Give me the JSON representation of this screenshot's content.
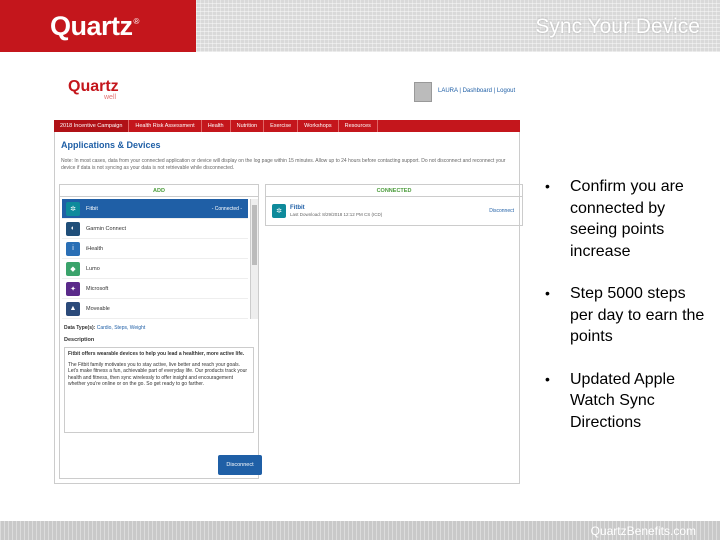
{
  "slide": {
    "brand": "Quartz",
    "brand_tm": "®",
    "title": "Sync Your Device",
    "footer": "QuartzBenefits.com",
    "bullets": [
      "Confirm you are connected by seeing points increase",
      "Step 5000 steps per day to earn the points",
      "Updated Apple Watch Sync Directions"
    ]
  },
  "screenshot": {
    "logo": "Quartz",
    "logo_sub": "well",
    "user_links": "LAURA | Dashboard | Logout",
    "nav": [
      "2018 Incentive Campaign",
      "Health Risk Assessment",
      "Health",
      "Nutrition",
      "Exercise",
      "Workshops",
      "Resources"
    ],
    "page_title": "Applications & Devices",
    "note": "Note: In most cases, data from your connected application or device will display on the log page within 15 minutes. Allow up to 24 hours before contacting support. Do not disconnect and reconnect your device if data is not syncing as your data is not retrievable while disconnected.",
    "add_header": "ADD",
    "connected_header": "CONNECTED",
    "apps": [
      {
        "name": "Fitbit",
        "state": "- Connected -",
        "icon": "fitbit-icon",
        "color": "#0e8a9b"
      },
      {
        "name": "Garmin Connect",
        "state": "",
        "icon": "garmin-icon",
        "color": "#1f4e79"
      },
      {
        "name": "iHealth",
        "state": "",
        "icon": "ihealth-icon",
        "color": "#2a6fb5"
      },
      {
        "name": "Lumo",
        "state": "",
        "icon": "lumo-icon",
        "color": "#3aa36b"
      },
      {
        "name": "Microsoft",
        "state": "",
        "icon": "microsoft-icon",
        "color": "#5a2a8a"
      },
      {
        "name": "Moveable",
        "state": "",
        "icon": "moveable-icon",
        "color": "#2b4a7a"
      }
    ],
    "data_types_label": "Data Type(s):",
    "data_types_value": "Cardio, Steps, Weight",
    "description_label": "Description",
    "description_bold": "Fitbit offers wearable devices to help you lead a healthier, more active life.",
    "description_body": "The Fitbit family motivates you to stay active, live better and reach your goals. Let's make fitness a fun, achievable part of everyday life. Our products track your health and fitness, then sync wirelessly to offer insight and encouragement whether you're online or on the go. So get ready to go farther.",
    "disconnect_label": "Disconnect",
    "connected": {
      "name": "Fitbit",
      "last_download": "Last Download: 8/29/2018 12:12 PM CS (ICD)",
      "action": "Disconnect"
    }
  }
}
